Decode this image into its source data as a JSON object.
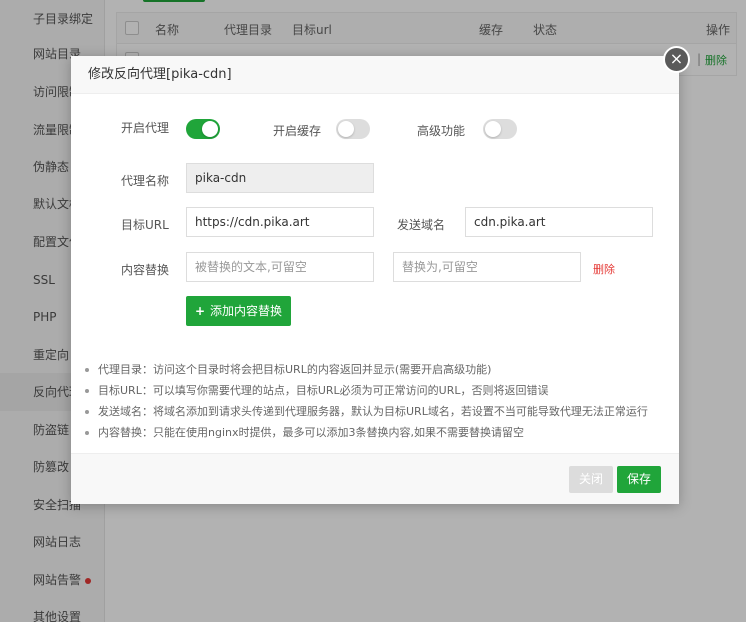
{
  "sidebar": {
    "items": [
      {
        "label": "子目录绑定"
      },
      {
        "label": "网站目录"
      },
      {
        "label": "访问限制"
      },
      {
        "label": "流量限制"
      },
      {
        "label": "伪静态"
      },
      {
        "label": "默认文档"
      },
      {
        "label": "配置文件"
      },
      {
        "label": "SSL"
      },
      {
        "label": "PHP"
      },
      {
        "label": "重定向"
      },
      {
        "label": "反向代理"
      },
      {
        "label": "防盗链"
      },
      {
        "label": "防篡改"
      },
      {
        "label": "安全扫描"
      },
      {
        "label": "网站日志"
      },
      {
        "label": "网站告警"
      },
      {
        "label": "其他设置"
      }
    ]
  },
  "table": {
    "columns": [
      "名称",
      "代理目录",
      "目标url",
      "缓存",
      "状态",
      "操作"
    ],
    "row": {
      "separator": "|",
      "delete": "删除"
    }
  },
  "modal": {
    "title": "修改反向代理[pika-cdn]",
    "close_icon": "×",
    "toggles": {
      "enable_proxy": {
        "label": "开启代理",
        "on": true
      },
      "enable_cache": {
        "label": "开启缓存",
        "on": false
      },
      "advanced": {
        "label": "高级功能",
        "on": false
      }
    },
    "proxy_name": {
      "label": "代理名称",
      "value": "pika-cdn"
    },
    "target_url": {
      "label": "目标URL",
      "value": "https://cdn.pika.art"
    },
    "send_domain": {
      "label": "发送域名",
      "value": "cdn.pika.art"
    },
    "content_replace": {
      "label": "内容替换",
      "from_placeholder": "被替换的文本,可留空",
      "to_placeholder": "替换为,可留空",
      "delete_label": "删除"
    },
    "add_button": {
      "plus": "+",
      "label": "添加内容替换"
    },
    "tips": [
      "代理目录：访问这个目录时将会把目标URL的内容返回并显示(需要开启高级功能)",
      "目标URL：可以填写你需要代理的站点，目标URL必须为可正常访问的URL，否则将返回错误",
      "发送域名：将域名添加到请求头传递到代理服务器，默认为目标URL域名，若设置不当可能导致代理无法正常运行",
      "内容替换：只能在使用nginx时提供，最多可以添加3条替换内容,如果不需要替换请留空"
    ],
    "footer": {
      "close_label": "关闭",
      "save_label": "保存"
    }
  },
  "colors": {
    "accent": "#20a53a",
    "danger": "#e53935",
    "overlay": "rgba(0,0,0,0.30)"
  }
}
